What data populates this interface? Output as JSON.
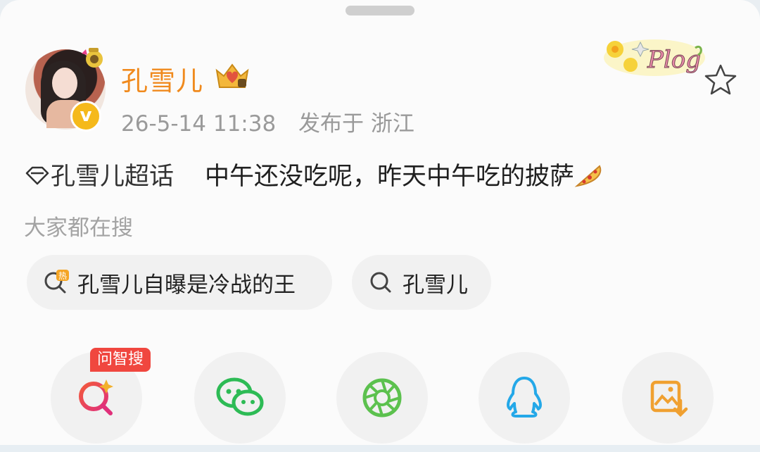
{
  "post": {
    "author": "孔雪儿",
    "timestamp": "26-5-14 11:38",
    "location_prefix": "发布于",
    "location": "浙江",
    "topic": "孔雪儿超话",
    "text": "中午还没吃呢，昨天中午吃的披萨"
  },
  "search_section": {
    "title": "大家都在搜",
    "chips": [
      {
        "label": "孔雪儿自曝是冷战的王",
        "icon": "hot-search-icon"
      },
      {
        "label": "孔雪儿",
        "icon": "search-icon"
      }
    ]
  },
  "share_bar": {
    "badge": "问智搜",
    "items": [
      {
        "icon": "ai-search-icon"
      },
      {
        "icon": "wechat-icon"
      },
      {
        "icon": "moments-icon"
      },
      {
        "icon": "qq-icon"
      },
      {
        "icon": "save-image-icon"
      }
    ]
  },
  "colors": {
    "author_name": "#f08a1d",
    "meta_text": "#9a9a9a",
    "badge_bg": "#f0473f",
    "verified_badge": "#f5b91b"
  }
}
